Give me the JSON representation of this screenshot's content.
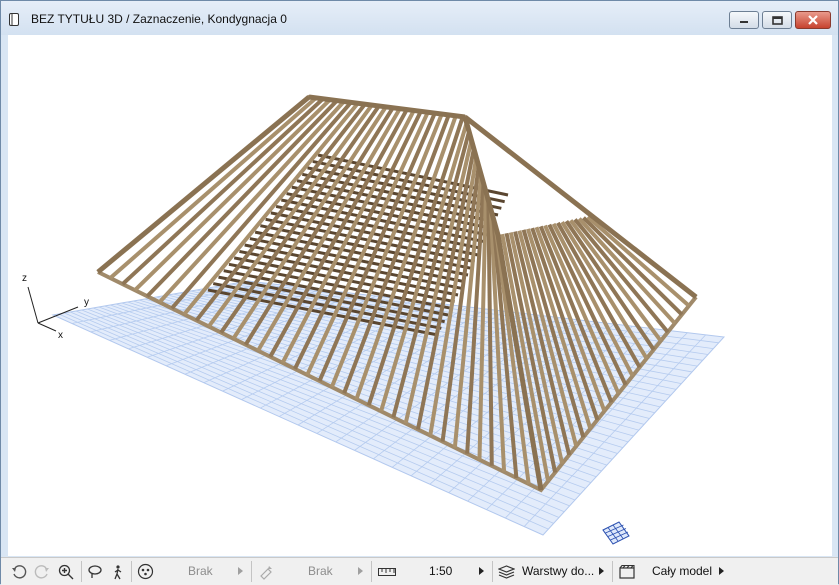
{
  "window": {
    "title": "BEZ TYTUŁU 3D / Zaznaczenie, Kondygnacja 0",
    "buttons": [
      "minimize-icon",
      "maximize-icon",
      "close-icon"
    ]
  },
  "viewport": {
    "axes": {
      "x": "x",
      "y": "y",
      "z": "z"
    },
    "colors": {
      "timber": "#a08a6a",
      "timber_dark": "#4a3a28",
      "grid_fill": "#dfe9fb",
      "grid_line": "#b2c8ee"
    }
  },
  "statusbar": {
    "icons": [
      "orbit-undo-icon",
      "orbit-redo-icon",
      "zoom-in-icon",
      "lasso-orbit-icon",
      "walk-icon",
      "navigator-icon",
      "renovation-filter-icon",
      "scale-icon",
      "layers-icon",
      "model-view-icon"
    ],
    "navigator_value": "Brak",
    "renovation_value": "Brak",
    "scale_value": "1:50",
    "layers_value": "Warstwy do...",
    "model_value": "Cały model"
  }
}
